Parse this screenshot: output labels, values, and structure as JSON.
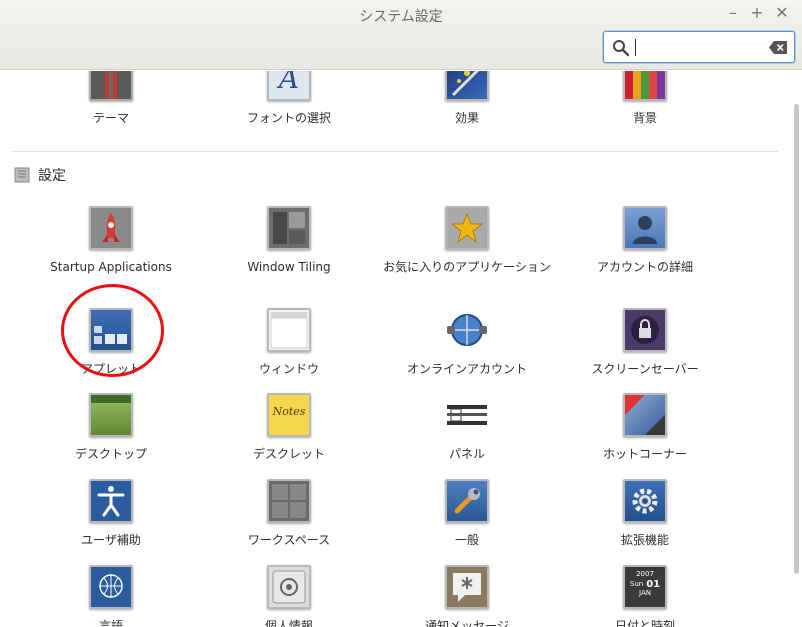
{
  "window": {
    "title": "システム設定",
    "controls": [
      "–",
      "+",
      "✕"
    ]
  },
  "search": {
    "value": "",
    "placeholder": ""
  },
  "top_row": [
    {
      "label": "テーマ",
      "icon": "theme-icon"
    },
    {
      "label": "フォントの選択",
      "icon": "font-icon"
    },
    {
      "label": "効果",
      "icon": "effects-icon"
    },
    {
      "label": "背景",
      "icon": "background-icon"
    }
  ],
  "section": {
    "title": "設定",
    "icon": "settings-section-icon"
  },
  "items": [
    {
      "label": "Startup Applications",
      "icon": "startup-rocket-icon"
    },
    {
      "label": "Window Tiling",
      "icon": "window-tiling-icon"
    },
    {
      "label": "お気に入りのアプリケーション",
      "icon": "star-icon"
    },
    {
      "label": "アカウントの詳細",
      "icon": "user-icon"
    },
    {
      "label": "アプレット",
      "icon": "applets-icon"
    },
    {
      "label": "ウィンドウ",
      "icon": "window-icon"
    },
    {
      "label": "オンラインアカウント",
      "icon": "online-accounts-icon"
    },
    {
      "label": "スクリーンセーバー",
      "icon": "screensaver-lock-icon"
    },
    {
      "label": "デスクトップ",
      "icon": "desktop-icon"
    },
    {
      "label": "デスクレット",
      "icon": "desklet-note-icon"
    },
    {
      "label": "パネル",
      "icon": "panel-icon"
    },
    {
      "label": "ホットコーナー",
      "icon": "hot-corner-icon"
    },
    {
      "label": "ユーザ補助",
      "icon": "accessibility-icon"
    },
    {
      "label": "ワークスペース",
      "icon": "workspaces-icon"
    },
    {
      "label": "一般",
      "icon": "general-wrench-icon"
    },
    {
      "label": "拡張機能",
      "icon": "extensions-gear-icon"
    },
    {
      "label": "言語",
      "icon": "language-globe-icon"
    },
    {
      "label": "個人情報",
      "icon": "privacy-safe-icon"
    },
    {
      "label": "通知メッセージ",
      "icon": "notifications-icon"
    },
    {
      "label": "日付と時刻",
      "icon": "date-time-icon"
    }
  ],
  "calendar": {
    "year": "2007",
    "day_name": "Sun",
    "day": "01",
    "month": "JAN"
  },
  "desklet_note_text": "Notes",
  "colors": {
    "highlight_circle": "#e81010",
    "search_focus": "#5d8fc8"
  }
}
